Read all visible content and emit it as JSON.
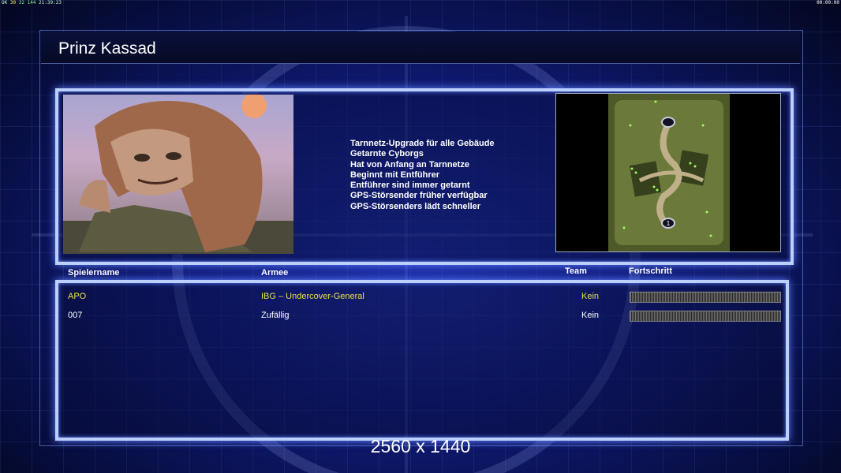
{
  "osd": {
    "left_prefix": "OK",
    "left_a": "30",
    "left_b": "32",
    "left_c": "144",
    "left_time": "21:39:23",
    "right_time": "00:00:00"
  },
  "header": {
    "title": "Prinz Kassad"
  },
  "general": {
    "features": [
      "Tarnnetz-Upgrade für alle Gebäude",
      "Getarnte Cyborgs",
      "Hat von Anfang an Tarnnetze",
      "Beginnt mit Entführer",
      "Entführer sind immer getarnt",
      "GPS-Störsender früher verfügbar",
      "GPS-Störsenders lädt schneller"
    ]
  },
  "minimap": {
    "start_marker": "1"
  },
  "columns": {
    "name": "Spielername",
    "army": "Armee",
    "team": "Team",
    "progress": "Fortschritt"
  },
  "players": [
    {
      "name": "APO",
      "army": "IBG – Undercover-General",
      "team": "Kein",
      "progress": 0,
      "color": "#e8e04a"
    },
    {
      "name": "007",
      "army": "Zufällig",
      "team": "Kein",
      "progress": 0,
      "color": "#ffffff"
    }
  ],
  "resolution_label": "2560 x 1440"
}
